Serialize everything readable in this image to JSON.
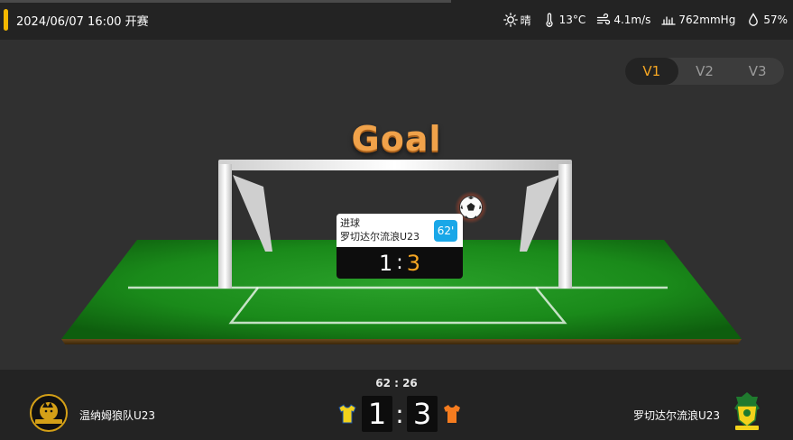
{
  "header": {
    "match_time": "2024/06/07 16:00 开赛",
    "weather": {
      "condition": "晴",
      "temperature": "13°C",
      "wind": "4.1m/s",
      "pressure": "762mmHg",
      "humidity": "57%"
    }
  },
  "version_switch": {
    "options": [
      "V1",
      "V2",
      "V3"
    ],
    "selected": "V1"
  },
  "animation": {
    "title": "Goal",
    "event": {
      "type": "进球",
      "team": "罗切达尔流浪U23",
      "minute": "62'",
      "score_home": "1",
      "score_sep": ":",
      "score_away": "3"
    }
  },
  "match": {
    "clock": "62 : 26",
    "home": {
      "name": "温纳姆狼队U23",
      "score": "1",
      "jersey_color": "#f2d21b"
    },
    "away": {
      "name": "罗切达尔流浪U23",
      "score": "3",
      "jersey_color": "#f57c1f"
    },
    "separator": ":"
  },
  "colors": {
    "accent": "#f5b800",
    "active_version": "#f5a623",
    "minute_badge": "#19a7e8",
    "grass": "#1f8a1f",
    "goal_text": "#f0a24a"
  }
}
